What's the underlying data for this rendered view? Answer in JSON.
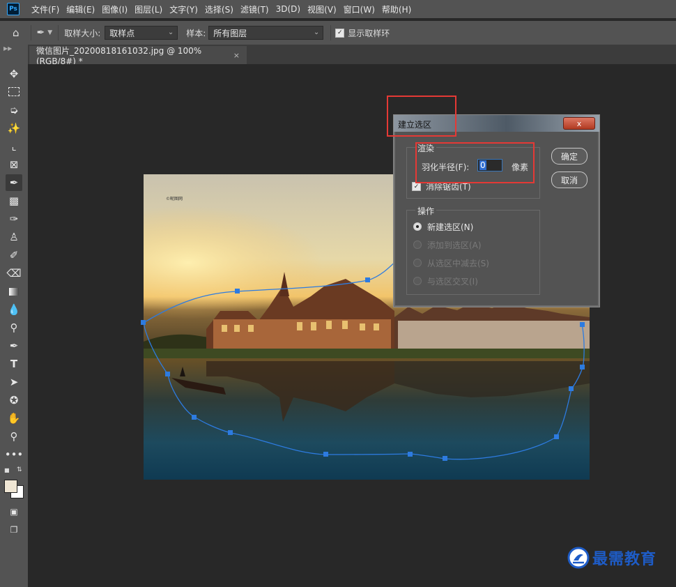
{
  "menubar": {
    "logo": "Ps",
    "items": [
      "文件(F)",
      "编辑(E)",
      "图像(I)",
      "图层(L)",
      "文字(Y)",
      "选择(S)",
      "滤镜(T)",
      "3D(D)",
      "视图(V)",
      "窗口(W)",
      "帮助(H)"
    ]
  },
  "options": {
    "sample_size_label": "取样大小:",
    "sample_size_value": "取样点",
    "sample_label": "样本:",
    "sample_value": "所有图层",
    "show_ring_label": "显示取样环"
  },
  "tab": {
    "title": "微信图片_20200818161032.jpg @ 100%(RGB/8#) *",
    "close": "×"
  },
  "photo": {
    "watermark": "©昵图网"
  },
  "dialog": {
    "title": "建立选区",
    "close": "x",
    "render_group": "渲染",
    "feather_label": "羽化半径(F):",
    "feather_value": "0",
    "feather_unit": "像素",
    "antialias_label": "消除锯齿(T)",
    "operation_group": "操作",
    "options": [
      {
        "label": "新建选区(N)",
        "enabled": true,
        "selected": true
      },
      {
        "label": "添加到选区(A)",
        "enabled": false,
        "selected": false
      },
      {
        "label": "从选区中减去(S)",
        "enabled": false,
        "selected": false
      },
      {
        "label": "与选区交叉(I)",
        "enabled": false,
        "selected": false
      }
    ],
    "ok": "确定",
    "cancel": "取消"
  },
  "brand": {
    "text": "最需教育",
    "color": "#1e5cc7"
  },
  "colors": {
    "highlight": "#e53935",
    "path": "#2d7be0",
    "ui_panel": "#535353"
  }
}
